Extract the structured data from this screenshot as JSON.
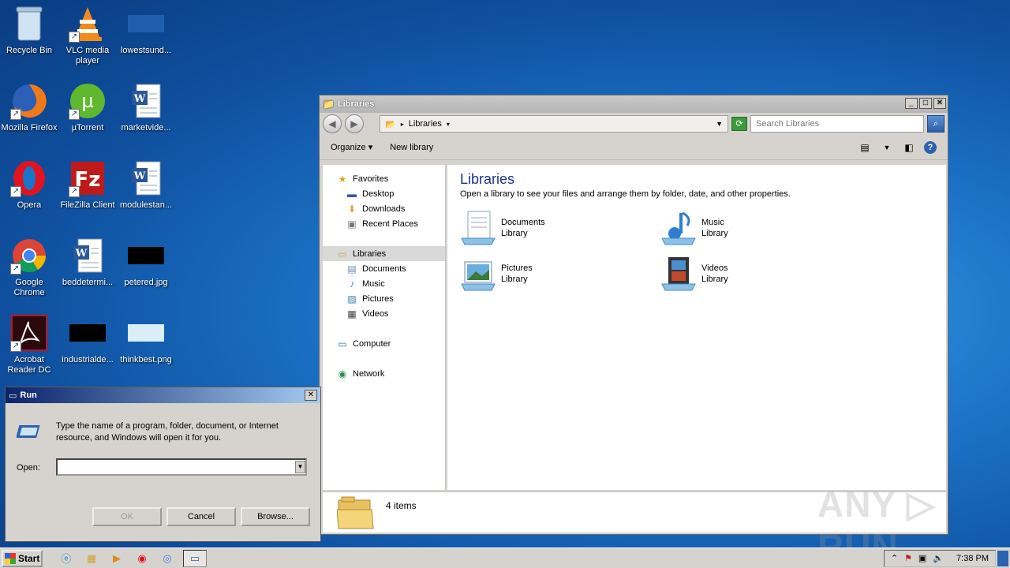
{
  "desktop": {
    "icons": [
      {
        "label": "Recycle Bin",
        "icon": "recycle-bin-icon"
      },
      {
        "label": "VLC media player",
        "icon": "vlc-icon"
      },
      {
        "label": "lowestsund...",
        "icon": "image-file-icon"
      },
      {
        "label": "Mozilla Firefox",
        "icon": "firefox-icon"
      },
      {
        "label": "µTorrent",
        "icon": "utorrent-icon"
      },
      {
        "label": "marketvide...",
        "icon": "word-doc-icon"
      },
      {
        "label": "Opera",
        "icon": "opera-icon"
      },
      {
        "label": "FileZilla Client",
        "icon": "filezilla-icon"
      },
      {
        "label": "modulestan...",
        "icon": "word-doc-icon"
      },
      {
        "label": "Google Chrome",
        "icon": "chrome-icon"
      },
      {
        "label": "beddetermi...",
        "icon": "word-doc-icon"
      },
      {
        "label": "petered.jpg",
        "icon": "image-file-icon"
      },
      {
        "label": "Acrobat Reader DC",
        "icon": "acrobat-icon"
      },
      {
        "label": "industrialde...",
        "icon": "image-file-icon"
      },
      {
        "label": "thinkbest.png",
        "icon": "image-file-icon"
      }
    ]
  },
  "explorer": {
    "title": "Libraries",
    "address_crumb": "Libraries",
    "search_placeholder": "Search Libraries",
    "toolbar": {
      "organize": "Organize",
      "new_library": "New library"
    },
    "nav": {
      "favorites": "Favorites",
      "desktop": "Desktop",
      "downloads": "Downloads",
      "recent_places": "Recent Places",
      "libraries": "Libraries",
      "documents": "Documents",
      "music": "Music",
      "pictures": "Pictures",
      "videos": "Videos",
      "computer": "Computer",
      "network": "Network"
    },
    "content": {
      "heading": "Libraries",
      "description": "Open a library to see your files and arrange them by folder, date, and other properties.",
      "libraries": [
        {
          "name": "Documents",
          "type": "Library"
        },
        {
          "name": "Music",
          "type": "Library"
        },
        {
          "name": "Pictures",
          "type": "Library"
        },
        {
          "name": "Videos",
          "type": "Library"
        }
      ]
    },
    "status": {
      "count": "4 items"
    }
  },
  "run_dialog": {
    "title": "Run",
    "description": "Type the name of a program, folder, document, or Internet resource, and Windows will open it for you.",
    "open_label": "Open:",
    "open_value": "",
    "ok_label": "OK",
    "cancel_label": "Cancel",
    "browse_label": "Browse..."
  },
  "taskbar": {
    "start_label": "Start",
    "clock": "7:38 PM"
  },
  "watermark": "ANY ▷ RUN"
}
